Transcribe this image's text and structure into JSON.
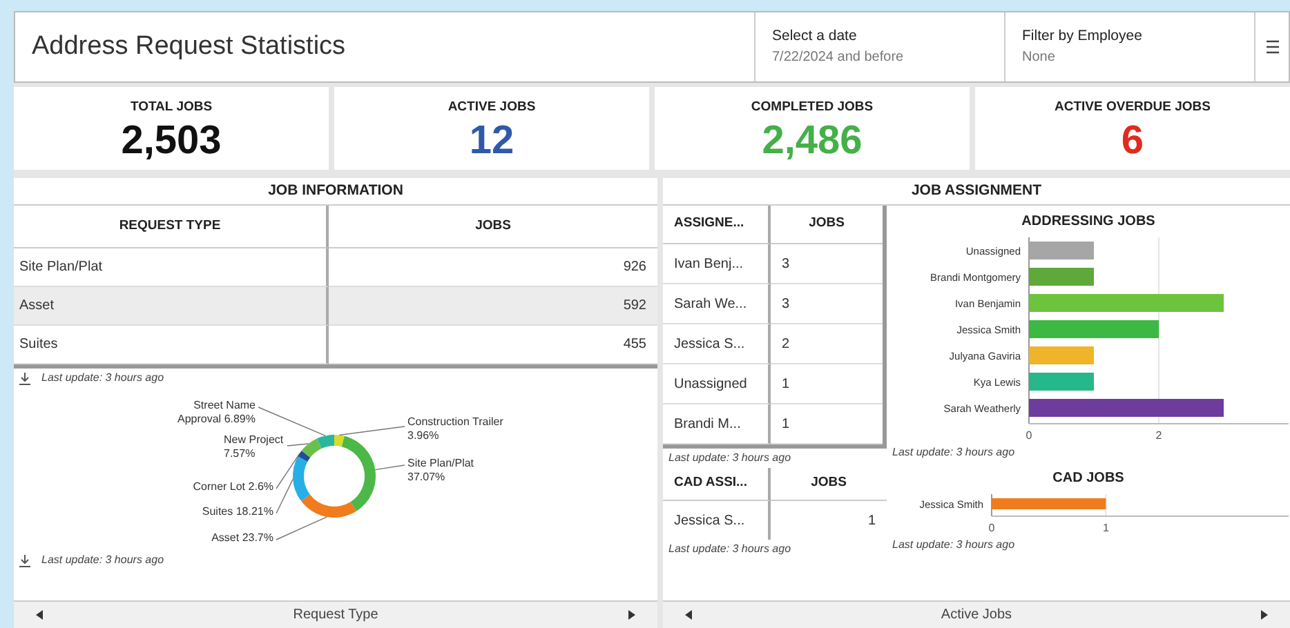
{
  "header": {
    "title": "Address Request Statistics",
    "filters": [
      {
        "label": "Select a date",
        "value": "7/22/2024 and before"
      },
      {
        "label": "Filter by Employee",
        "value": "None"
      }
    ]
  },
  "kpis": [
    {
      "label": "TOTAL JOBS",
      "value": "2,503",
      "color": "#111111"
    },
    {
      "label": "ACTIVE JOBS",
      "value": "12",
      "color": "#2f5aa8"
    },
    {
      "label": "COMPLETED JOBS",
      "value": "2,486",
      "color": "#45b048"
    },
    {
      "label": "ACTIVE OVERDUE JOBS",
      "value": "6",
      "color": "#e02b20"
    }
  ],
  "job_information": {
    "title": "JOB INFORMATION",
    "table": {
      "columns": [
        "REQUEST TYPE",
        "JOBS"
      ],
      "rows": [
        {
          "cells": [
            "Site Plan/Plat",
            "926"
          ],
          "selected": false
        },
        {
          "cells": [
            "Asset",
            "592"
          ],
          "selected": true
        },
        {
          "cells": [
            "Suites",
            "455"
          ],
          "selected": false
        }
      ]
    },
    "table_update": "Last update: 3 hours ago",
    "chart_data": {
      "type": "donut",
      "categories": [
        "Construction Trailer",
        "Site Plan/Plat",
        "Asset",
        "Suites",
        "Corner Lot",
        "New Project",
        "Street Name Approval"
      ],
      "values": [
        3.96,
        37.07,
        23.7,
        18.21,
        2.6,
        7.57,
        6.89
      ],
      "colors": [
        "#d8dc2a",
        "#4cb848",
        "#f07c1e",
        "#27aee6",
        "#1f4e9a",
        "#6cc04a",
        "#2bb89a"
      ],
      "value_labels": [
        "3.96%",
        "37.07%",
        "23.7%",
        "18.21%",
        "2.6%",
        "7.57%",
        "6.89%"
      ]
    },
    "chart_update": "Last update: 3 hours ago",
    "nav": "Request Type"
  },
  "job_assignment": {
    "title": "JOB ASSIGNMENT",
    "assignee_table": {
      "columns": [
        "ASSIGNE...",
        "JOBS"
      ],
      "rows": [
        [
          "Ivan Benj...",
          "3"
        ],
        [
          "Sarah We...",
          "3"
        ],
        [
          "Jessica S...",
          "2"
        ],
        [
          "Unassigned",
          "1"
        ],
        [
          "Brandi M...",
          "1"
        ]
      ]
    },
    "assignee_update": "Last update: 3 hours ago",
    "cad_table": {
      "columns": [
        "CAD ASSI...",
        "JOBS"
      ],
      "rows": [
        [
          "Jessica S...",
          "1"
        ]
      ]
    },
    "cad_table_update": "Last update: 3 hours ago",
    "addressing_chart": {
      "chart_data": {
        "type": "bar",
        "orientation": "horizontal",
        "title": "ADDRESSING JOBS",
        "categories": [
          "Unassigned",
          "Brandi Montgomery",
          "Ivan Benjamin",
          "Jessica Smith",
          "Julyana Gaviria",
          "Kya Lewis",
          "Sarah Weatherly"
        ],
        "values": [
          1,
          1,
          3,
          2,
          1,
          1,
          3
        ],
        "colors": [
          "#a6a6a6",
          "#5fa83a",
          "#6cc43c",
          "#3db843",
          "#f0b429",
          "#26b78a",
          "#6e3c9c"
        ],
        "xlim": [
          0,
          4
        ],
        "xticks": [
          0,
          2
        ]
      }
    },
    "addressing_update": "Last update: 3 hours ago",
    "cad_chart": {
      "chart_data": {
        "type": "bar",
        "orientation": "horizontal",
        "title": "CAD JOBS",
        "categories": [
          "Jessica Smith"
        ],
        "values": [
          1
        ],
        "colors": [
          "#f07c1e"
        ],
        "xlim": [
          0,
          2.6
        ],
        "xticks": [
          0,
          1
        ]
      }
    },
    "cad_update": "Last update: 3 hours ago",
    "nav": "Active Jobs"
  }
}
